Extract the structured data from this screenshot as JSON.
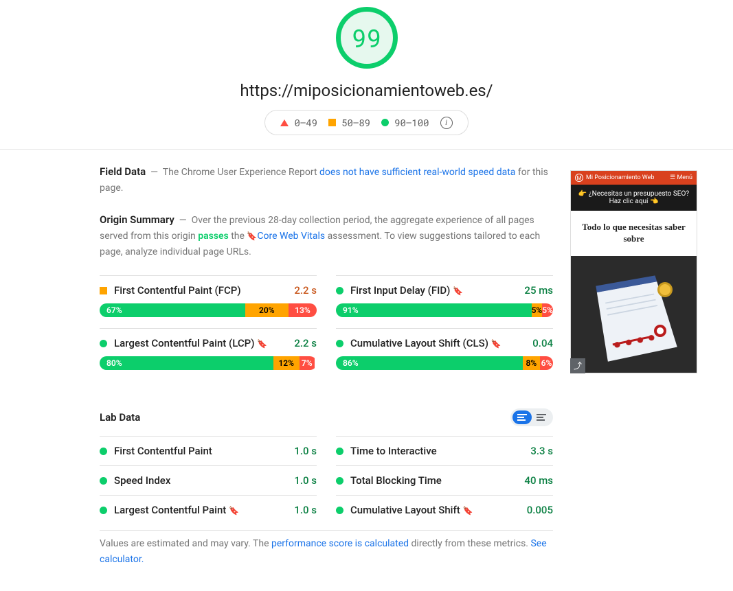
{
  "score": "99",
  "url": "https://miposicionamientoweb.es/",
  "legend": {
    "low": "0–49",
    "mid": "50–89",
    "high": "90–100"
  },
  "field_data": {
    "title": "Field Data",
    "prefix": "The Chrome User Experience Report ",
    "link": "does not have sufficient real-world speed data",
    "suffix": " for this page."
  },
  "origin": {
    "title": "Origin Summary",
    "prefix": "Over the previous 28-day collection period, the aggregate experience of all pages served from this origin ",
    "passes": "passes",
    "mid": " the  ",
    "cwv": "Core Web Vitals",
    "suffix": " assessment. To view suggestions tailored to each page, analyze individual page URLs."
  },
  "metrics": [
    {
      "mark": "sq",
      "name": "First Contentful Paint (FCP)",
      "bookmark": false,
      "value": "2.2 s",
      "valClass": "val-orange",
      "dist": {
        "g": 67,
        "o": 20,
        "r": 13
      }
    },
    {
      "mark": "dot",
      "name": "First Input Delay (FID)",
      "bookmark": true,
      "value": "25 ms",
      "valClass": "val-green",
      "dist": {
        "g": 91,
        "o": 5,
        "r": 5
      }
    },
    {
      "mark": "dot",
      "name": "Largest Contentful Paint (LCP)",
      "bookmark": true,
      "value": "2.2 s",
      "valClass": "val-green",
      "dist": {
        "g": 80,
        "o": 12,
        "r": 7
      }
    },
    {
      "mark": "dot",
      "name": "Cumulative Layout Shift (CLS)",
      "bookmark": true,
      "value": "0.04",
      "valClass": "val-green",
      "dist": {
        "g": 86,
        "o": 8,
        "r": 6
      }
    }
  ],
  "lab": {
    "title": "Lab Data",
    "rows_left": [
      {
        "name": "First Contentful Paint",
        "bookmark": false,
        "value": "1.0 s"
      },
      {
        "name": "Speed Index",
        "bookmark": false,
        "value": "1.0 s"
      },
      {
        "name": "Largest Contentful Paint",
        "bookmark": true,
        "value": "1.0 s"
      }
    ],
    "rows_right": [
      {
        "name": "Time to Interactive",
        "bookmark": false,
        "value": "3.3 s"
      },
      {
        "name": "Total Blocking Time",
        "bookmark": false,
        "value": "40 ms"
      },
      {
        "name": "Cumulative Layout Shift",
        "bookmark": true,
        "value": "0.005"
      }
    ]
  },
  "footnote": {
    "prefix": "Values are estimated and may vary. The ",
    "link1": "performance score is calculated",
    "mid": " directly from these metrics. ",
    "link2": "See calculator."
  },
  "thumb": {
    "brand": "Mi Posicionamiento Web",
    "menu": "Menú",
    "banner": "👉 ¿Necesitas un presupuesto SEO? Haz clic aquí 👈",
    "hero": "Todo lo que necesitas saber sobre"
  }
}
